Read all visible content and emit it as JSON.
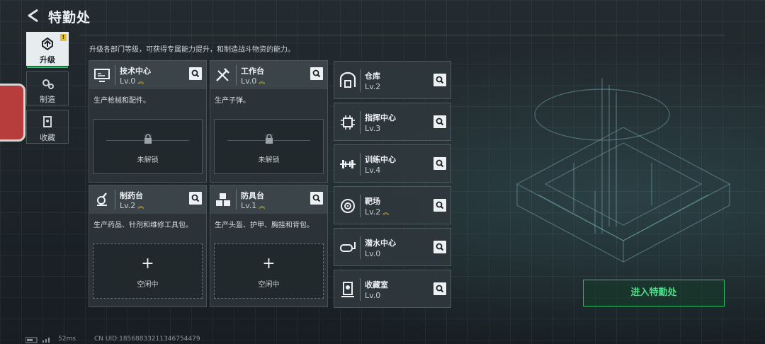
{
  "header": {
    "title": "特勤处"
  },
  "sidebar": {
    "items": [
      {
        "label": "升级",
        "icon": "upgrade-icon",
        "active": true,
        "badge": "!"
      },
      {
        "label": "制造",
        "icon": "gears-icon",
        "active": false
      },
      {
        "label": "收藏",
        "icon": "collection-icon",
        "active": false
      }
    ]
  },
  "main": {
    "description": "升级各部门等级，可获得专属能力提升，和制造战斗物资的能力。",
    "departments": [
      {
        "name": "技术中心",
        "level": "Lv.0",
        "upgradable": true,
        "desc": "生产枪械和配件。",
        "slot_label": "未解锁",
        "slot_state": "locked",
        "icon": "tech-center-icon"
      },
      {
        "name": "工作台",
        "level": "Lv.0",
        "upgradable": true,
        "desc": "生产子弹。",
        "slot_label": "未解锁",
        "slot_state": "locked",
        "icon": "workbench-icon"
      },
      {
        "name": "制药台",
        "level": "Lv.2",
        "upgradable": true,
        "desc": "生产药品、针剂和维修工具包。",
        "slot_label": "空闲中",
        "slot_state": "idle",
        "icon": "pharmacy-icon"
      },
      {
        "name": "防具台",
        "level": "Lv.1",
        "upgradable": true,
        "desc": "生产头盔、护甲、胸挂和背包。",
        "slot_label": "空闲中",
        "slot_state": "idle",
        "icon": "armor-bench-icon"
      }
    ],
    "rooms": [
      {
        "name": "仓库",
        "level": "Lv.2",
        "upgradable": false,
        "icon": "warehouse-icon"
      },
      {
        "name": "指挥中心",
        "level": "Lv.3",
        "upgradable": false,
        "icon": "command-center-icon"
      },
      {
        "name": "训练中心",
        "level": "Lv.4",
        "upgradable": false,
        "icon": "training-center-icon"
      },
      {
        "name": "靶场",
        "level": "Lv.2",
        "upgradable": true,
        "icon": "shooting-range-icon"
      },
      {
        "name": "潜水中心",
        "level": "Lv.0",
        "upgradable": false,
        "icon": "diving-center-icon"
      },
      {
        "name": "收藏室",
        "level": "Lv.0",
        "upgradable": false,
        "icon": "collection-room-icon"
      }
    ]
  },
  "actions": {
    "enter_label": "进入特勤处"
  },
  "status": {
    "ping": "52ms",
    "uid": "CN UID:18568833211346754479"
  },
  "colors": {
    "accent_green": "#2fbf68",
    "upgrade_chevron": "#e8c12a",
    "badge_yellow": "#e8c12a"
  }
}
